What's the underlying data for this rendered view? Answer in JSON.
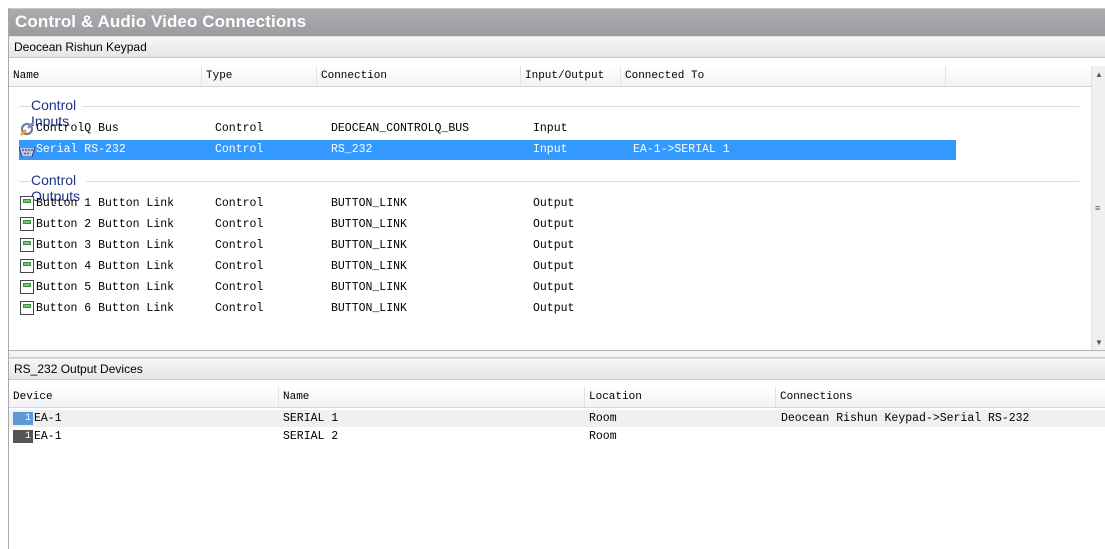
{
  "window": {
    "title": "Control & Audio Video Connections"
  },
  "device_header": "Deocean Rishun Keypad",
  "connections_table": {
    "columns": [
      "Name",
      "Type",
      "Connection",
      "Input/Output",
      "Connected To"
    ],
    "groups": [
      {
        "label": "Control Inputs",
        "rows": [
          {
            "icon": "controlq-bus-icon",
            "name": "ControlQ Bus",
            "type": "Control",
            "connection": "DEOCEAN_CONTROLQ_BUS",
            "io": "Input",
            "connected_to": ""
          },
          {
            "icon": "serial-port-icon",
            "name": "Serial RS-232",
            "type": "Control",
            "connection": "RS_232",
            "io": "Input",
            "connected_to": "EA-1->SERIAL 1",
            "selected": true
          }
        ]
      },
      {
        "label": "Control Outputs",
        "rows": [
          {
            "icon": "button-link-icon",
            "name": "Button 1 Button Link",
            "type": "Control",
            "connection": "BUTTON_LINK",
            "io": "Output",
            "connected_to": ""
          },
          {
            "icon": "button-link-icon",
            "name": "Button 2 Button Link",
            "type": "Control",
            "connection": "BUTTON_LINK",
            "io": "Output",
            "connected_to": ""
          },
          {
            "icon": "button-link-icon",
            "name": "Button 3 Button Link",
            "type": "Control",
            "connection": "BUTTON_LINK",
            "io": "Output",
            "connected_to": ""
          },
          {
            "icon": "button-link-icon",
            "name": "Button 4 Button Link",
            "type": "Control",
            "connection": "BUTTON_LINK",
            "io": "Output",
            "connected_to": ""
          },
          {
            "icon": "button-link-icon",
            "name": "Button 5 Button Link",
            "type": "Control",
            "connection": "BUTTON_LINK",
            "io": "Output",
            "connected_to": ""
          },
          {
            "icon": "button-link-icon",
            "name": "Button 6 Button Link",
            "type": "Control",
            "connection": "BUTTON_LINK",
            "io": "Output",
            "connected_to": ""
          }
        ]
      }
    ]
  },
  "output_devices": {
    "header": "RS_232 Output Devices",
    "columns": [
      "Device",
      "Name",
      "Location",
      "Connections"
    ],
    "rows": [
      {
        "badge": "1",
        "badge_color": "#5b9bd5",
        "device": "EA-1",
        "name": "SERIAL 1",
        "location": "Room",
        "connections": "Deocean Rishun Keypad->Serial RS-232"
      },
      {
        "badge": "1",
        "badge_color": "#555555",
        "device": "EA-1",
        "name": "SERIAL 2",
        "location": "Room",
        "connections": ""
      }
    ]
  },
  "colors": {
    "selection": "#3399ff",
    "group_label": "#1e3287",
    "title_bar": "#a3a5a8"
  }
}
